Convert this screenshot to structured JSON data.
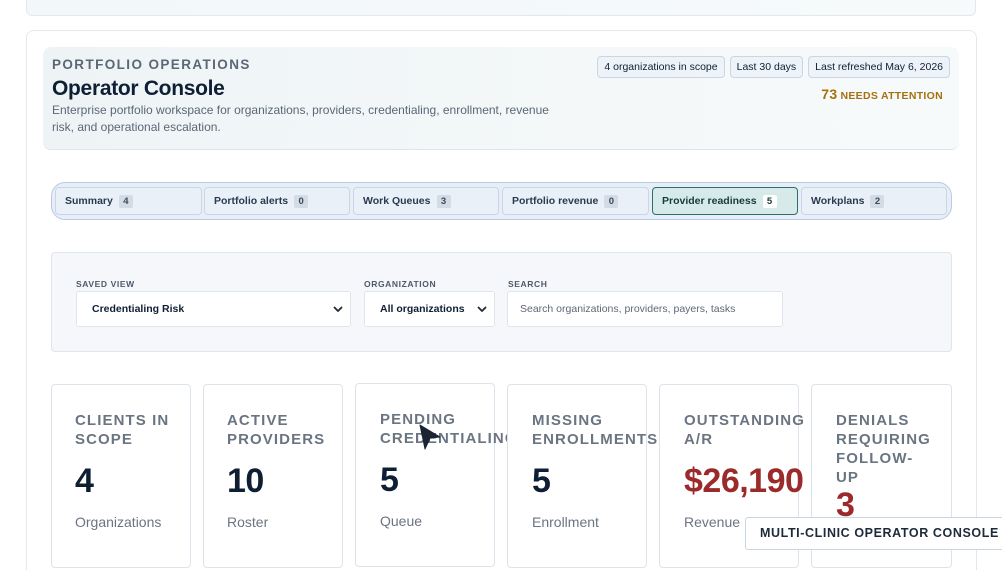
{
  "header": {
    "eyebrow": "PORTFOLIO OPERATIONS",
    "title": "Operator Console",
    "description": "Enterprise portfolio workspace for organizations, providers, credentialing, enrollment, revenue risk, and operational escalation.",
    "chips": [
      "4 organizations in scope",
      "Last 30 days",
      "Last refreshed May 6, 2026"
    ],
    "attention_count": "73",
    "attention_label": "NEEDS ATTENTION"
  },
  "tabs": [
    {
      "label": "Summary",
      "count": "4",
      "active": false
    },
    {
      "label": "Portfolio alerts",
      "count": "0",
      "active": false
    },
    {
      "label": "Work Queues",
      "count": "3",
      "active": false
    },
    {
      "label": "Portfolio revenue",
      "count": "0",
      "active": false
    },
    {
      "label": "Provider readiness",
      "count": "5",
      "active": true
    },
    {
      "label": "Workplans",
      "count": "2",
      "active": false
    }
  ],
  "filters": {
    "saved_view_label": "SAVED VIEW",
    "saved_view_value": "Credentialing Risk",
    "organization_label": "ORGANIZATION",
    "organization_value": "All organizations",
    "search_label": "SEARCH",
    "search_placeholder": "Search organizations, providers, payers, tasks"
  },
  "kpis": [
    {
      "label": "CLIENTS IN SCOPE",
      "value": "4",
      "sub": "Organizations"
    },
    {
      "label": "ACTIVE PROVIDERS",
      "value": "10",
      "sub": "Roster"
    },
    {
      "label": "PENDING CREDENTIALING",
      "value": "5",
      "sub": "Queue"
    },
    {
      "label": "MISSING ENROLLMENTS",
      "value": "5",
      "sub": "Enrollment"
    },
    {
      "label": "OUTSTANDING A/R",
      "value": "$26,190",
      "sub": "Revenue"
    },
    {
      "label": "DENIALS REQUIRING FOLLOW-UP",
      "value": "3",
      "sub": ""
    }
  ],
  "toast": "MULTI-CLINIC OPERATOR CONSOLE",
  "colors": {
    "accent": "#2f6e6a",
    "attention": "#a6700f",
    "danger": "#9b2a2a"
  }
}
